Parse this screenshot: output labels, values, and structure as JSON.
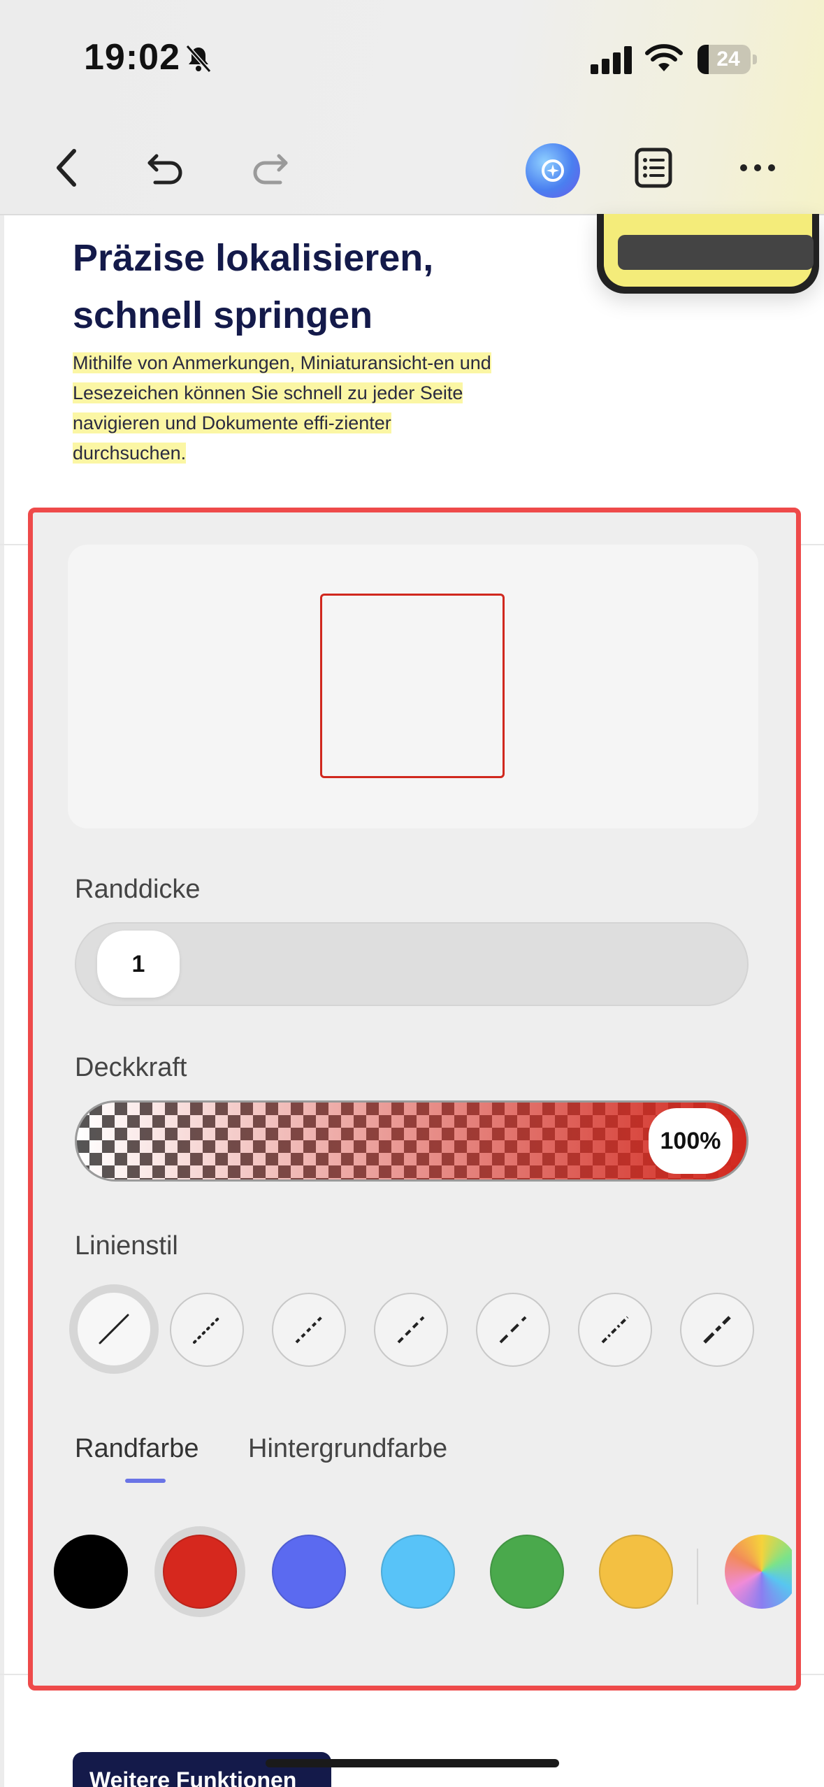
{
  "status_bar": {
    "time": "19:02",
    "battery": "24",
    "icons": [
      "bell-slash-icon",
      "cellular-signal-icon",
      "wifi-icon",
      "battery-icon"
    ]
  },
  "toolbar": {
    "icons": [
      "chevron-left-icon",
      "undo-icon",
      "redo-icon",
      "ai-assistant-icon",
      "outline-list-icon",
      "more-icon"
    ]
  },
  "document": {
    "title": "Präzise lokalisieren, schnell springen",
    "body": "Mithilfe von Anmerkungen, Miniaturansicht-en und Lesezeichen können Sie schnell zu jeder Seite navigieren und Dokumente effi-zienter durchsuchen.",
    "more_button": "Weitere Funktionen"
  },
  "panel": {
    "preview_stroke_color": "#d0281e",
    "border_width_label": "Randdicke",
    "border_width_value": "1",
    "opacity_label": "Deckkraft",
    "opacity_value": "100%",
    "line_style_label": "Linienstil",
    "line_styles": [
      "solid",
      "dotted",
      "dashed-short",
      "dashed-medium",
      "dashed-long",
      "dash-dot",
      "dash-long-gap"
    ],
    "selected_line_style": "solid",
    "tabs": [
      "Randfarbe",
      "Hintergrundfarbe"
    ],
    "active_tab": "Randfarbe",
    "colors": [
      "#000000",
      "#d6281e",
      "#5b6af0",
      "#58c3f8",
      "#4aa94c",
      "#f3c042"
    ],
    "selected_color": "#d6281e",
    "accent": "#6a74e6"
  }
}
